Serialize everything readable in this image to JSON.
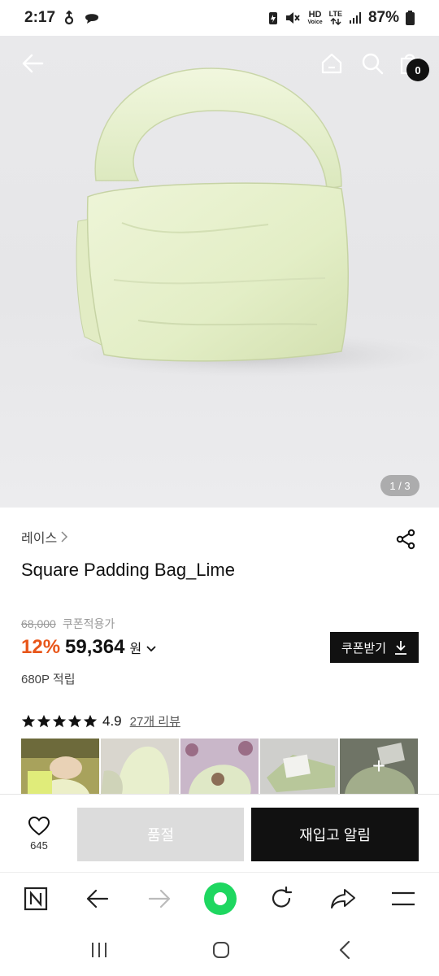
{
  "status_bar": {
    "time": "2:17",
    "battery": "87%",
    "hd_label": "HD",
    "voice_label": "Voice",
    "lte_label": "LTE"
  },
  "hero": {
    "pager": "1 / 3",
    "cart_count": "0"
  },
  "product": {
    "brand": "레이스",
    "name": "Square Padding Bag_Lime",
    "original_price": "68,000",
    "coupon_note": "쿠폰적용가",
    "discount": "12%",
    "price": "59,364",
    "currency": "원",
    "coupon_button": "쿠폰받기",
    "points": "680P 적립",
    "rating": "4.9",
    "review_link": "27개 리뷰",
    "stars_filled": 5
  },
  "actions": {
    "like_count": "645",
    "soldout_label": "품절",
    "restock_label": "재입고 알림"
  },
  "colors": {
    "accent": "#e8561a",
    "primary": "#111111",
    "disabled": "#dcdcdc",
    "browser_home": "#1ed760"
  }
}
